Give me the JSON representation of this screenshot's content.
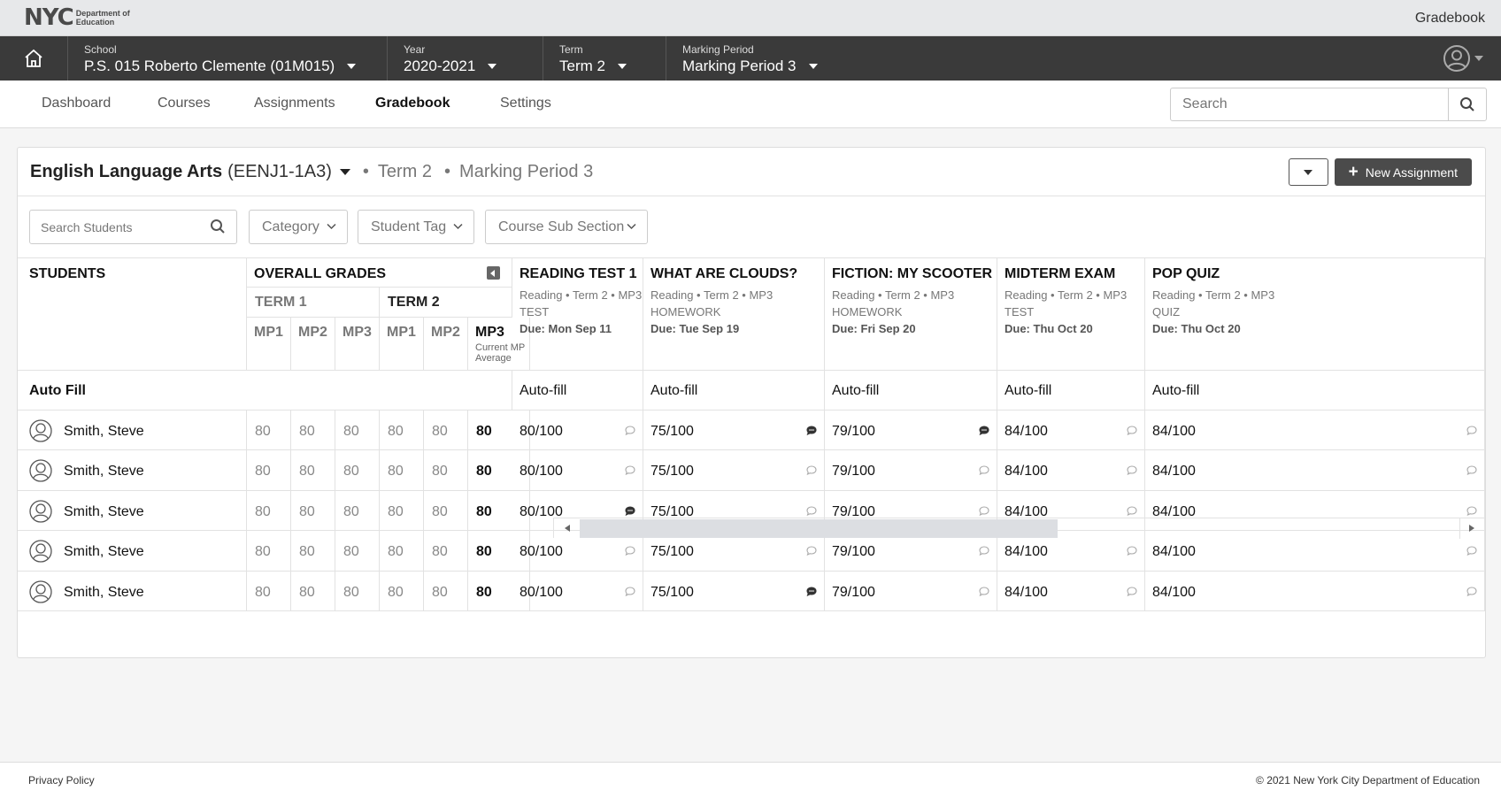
{
  "brand": {
    "logo_mark": "NYC",
    "logo_text": "Department of Education",
    "app_title": "Gradebook"
  },
  "context": {
    "school": {
      "label": "School",
      "value": "P.S. 015 Roberto Clemente (01M015)"
    },
    "year": {
      "label": "Year",
      "value": "2020-2021"
    },
    "term": {
      "label": "Term",
      "value": "Term 2"
    },
    "marking_period": {
      "label": "Marking Period",
      "value": "Marking Period 3"
    }
  },
  "nav": {
    "tabs": [
      "Dashboard",
      "Courses",
      "Assignments",
      "Gradebook",
      "Settings"
    ],
    "active": "Gradebook",
    "search_placeholder": "Search"
  },
  "course": {
    "name": "English Language Arts",
    "code": "(EENJ1-1A3)",
    "term": "Term 2",
    "marking_period": "Marking Period 3",
    "dot": "•",
    "new_assignment_label": "New Assignment"
  },
  "filters": {
    "search_placeholder": "Search Students",
    "category": "Category",
    "student_tag": "Student Tag",
    "sub_section": "Course Sub Section"
  },
  "grid": {
    "students_header": "STUDENTS",
    "overall_header": "OVERALL GRADES",
    "term1": "TERM 1",
    "term2": "TERM 2",
    "mp_labels": [
      "MP1",
      "MP2",
      "MP3",
      "MP1",
      "MP2",
      "MP3"
    ],
    "current_mp_note": "Current MP Average",
    "autofill_label": "Auto Fill",
    "autofill_cell": "Auto-fill",
    "assignments": [
      {
        "title": "READING TEST 1",
        "meta": "Reading • Term 2 • MP3",
        "type": "TEST",
        "due": "Due: Mon Sep 11"
      },
      {
        "title": "WHAT ARE CLOUDS?",
        "meta": "Reading • Term 2 • MP3",
        "type": "HOMEWORK",
        "due": "Due: Tue Sep 19"
      },
      {
        "title": "FICTION: MY SCOOTER",
        "meta": "Reading • Term 2 • MP3",
        "type": "HOMEWORK",
        "due": "Due: Fri Sep 20"
      },
      {
        "title": "MIDTERM EXAM",
        "meta": "Reading • Term 2 • MP3",
        "type": "TEST",
        "due": "Due: Thu Oct 20"
      },
      {
        "title": "POP QUIZ",
        "meta": "Reading • Term 2 • MP3",
        "type": "QUIZ",
        "due": "Due: Thu Oct 20"
      }
    ],
    "students": [
      {
        "name": "Smith, Steve",
        "grades": [
          "80",
          "80",
          "80",
          "80",
          "80",
          "80"
        ],
        "scores": [
          "80/100",
          "75/100",
          "79/100",
          "84/100",
          "84/100"
        ],
        "comments": [
          false,
          true,
          true,
          false,
          false
        ]
      },
      {
        "name": "Smith, Steve",
        "grades": [
          "80",
          "80",
          "80",
          "80",
          "80",
          "80"
        ],
        "scores": [
          "80/100",
          "75/100",
          "79/100",
          "84/100",
          "84/100"
        ],
        "comments": [
          false,
          false,
          false,
          false,
          false
        ]
      },
      {
        "name": "Smith, Steve",
        "grades": [
          "80",
          "80",
          "80",
          "80",
          "80",
          "80"
        ],
        "scores": [
          "80/100",
          "75/100",
          "79/100",
          "84/100",
          "84/100"
        ],
        "comments": [
          true,
          false,
          false,
          false,
          false
        ]
      },
      {
        "name": "Smith, Steve",
        "grades": [
          "80",
          "80",
          "80",
          "80",
          "80",
          "80"
        ],
        "scores": [
          "80/100",
          "75/100",
          "79/100",
          "84/100",
          "84/100"
        ],
        "comments": [
          false,
          false,
          false,
          false,
          false
        ]
      },
      {
        "name": "Smith, Steve",
        "grades": [
          "80",
          "80",
          "80",
          "80",
          "80",
          "80"
        ],
        "scores": [
          "80/100",
          "75/100",
          "79/100",
          "84/100",
          "84/100"
        ],
        "comments": [
          false,
          true,
          false,
          false,
          false
        ]
      }
    ]
  },
  "footer": {
    "privacy": "Privacy Policy",
    "copyright": "© 2021 New York City Department of Education"
  },
  "colors": {
    "dark_bar": "#3a3a3a",
    "primary_button": "#4b4b4b",
    "brand_bar": "#e7e8ea"
  }
}
